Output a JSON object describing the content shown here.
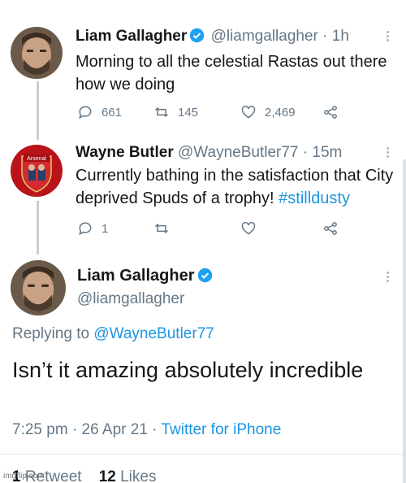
{
  "tweets": [
    {
      "name": "Liam Gallagher",
      "handle": "@liamgallagher",
      "sep": "·",
      "time": "1h",
      "text": "Morning to all the celestial Rastas out there how we doing",
      "replies": "661",
      "retweets": "145",
      "likes": "2,469",
      "verified": true
    },
    {
      "name": "Wayne Butler",
      "handle": "@WayneButler77",
      "sep": "·",
      "time": "15m",
      "text_plain": "Currently bathing in the satisfaction that City deprived Spuds of a trophy! ",
      "hashtag": "#stilldusty",
      "replies": "1",
      "avatar_badge_text": "Arsenal"
    }
  ],
  "focused": {
    "name": "Liam Gallagher",
    "handle": "@liamgallagher",
    "replying_label": "Replying to ",
    "replying_to": "@WayneButler77",
    "text": "Isn’t it amazing absolutely incredible",
    "time": "7:25 pm",
    "date": "26 Apr 21",
    "sep": "·",
    "source": "Twitter for iPhone",
    "retweets_count": "1",
    "retweets_label": "Retweet",
    "likes_count": "12",
    "likes_label": "Likes"
  },
  "watermark": "imgflip.com",
  "colors": {
    "accent": "#1b95e0",
    "muted": "#657786",
    "verified": "#1da1f2"
  }
}
